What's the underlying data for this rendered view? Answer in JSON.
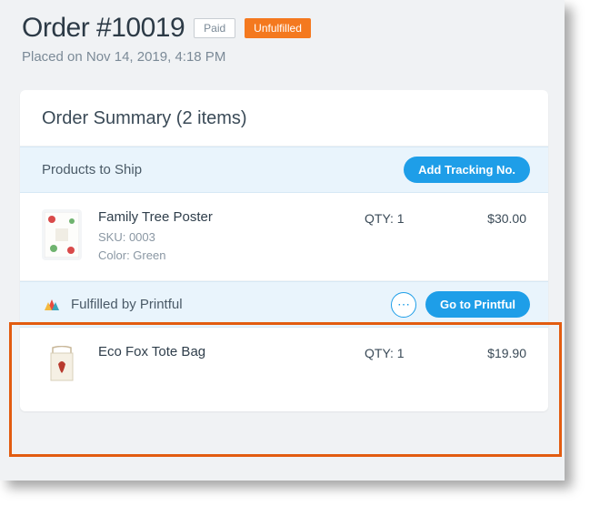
{
  "header": {
    "title": "Order #10019",
    "paid_badge": "Paid",
    "fulfill_badge": "Unfulfilled",
    "placed_on": "Placed on Nov 14, 2019, 4:18 PM"
  },
  "summary": {
    "title": "Order Summary (2 items)"
  },
  "ship_section": {
    "title": "Products to Ship",
    "add_tracking_label": "Add Tracking No."
  },
  "printful_section": {
    "title": "Fulfilled by Printful",
    "go_label": "Go to Printful",
    "ellipsis": "⋯"
  },
  "items_ship": [
    {
      "name": "Family Tree Poster",
      "sku": "SKU: 0003",
      "variant": "Color: Green",
      "qty_label": "QTY: 1",
      "price": "$30.00"
    }
  ],
  "items_printful": [
    {
      "name": "Eco Fox Tote Bag",
      "qty_label": "QTY: 1",
      "price": "$19.90"
    }
  ]
}
